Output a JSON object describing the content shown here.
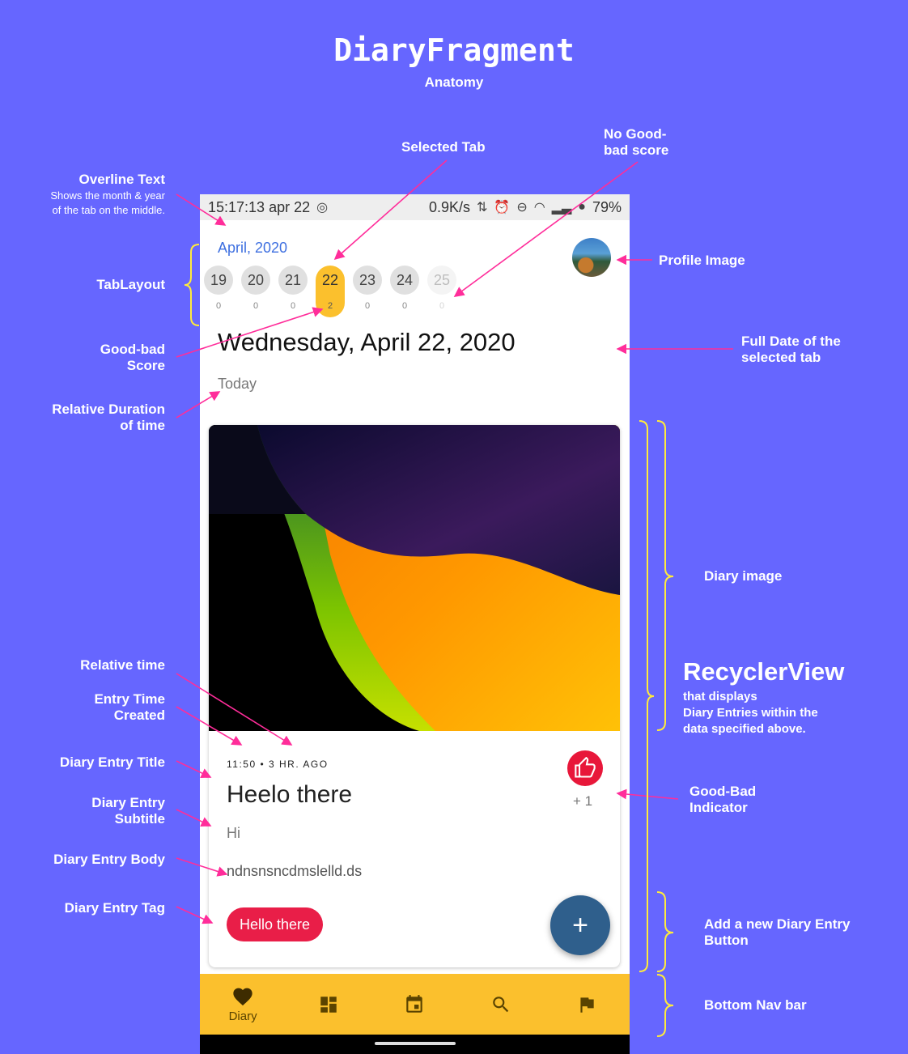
{
  "header": {
    "title": "DiaryFragment",
    "subtitle": "Anatomy"
  },
  "annotations": {
    "overline_text": "Overline Text",
    "overline_desc_1": "Shows the month & year",
    "overline_desc_2": "of the tab on the middle.",
    "selected_tab": "Selected Tab",
    "no_score_1": "No Good-",
    "no_score_2": "bad score",
    "profile_image": "Profile Image",
    "tab_layout": "TabLayout",
    "good_bad_score_1": "Good-bad",
    "good_bad_score_2": "Score",
    "full_date_1": "Full Date of the",
    "full_date_2": "selected tab",
    "relative_duration_1": "Relative Duration",
    "relative_duration_2": "of time",
    "diary_image": "Diary image",
    "recycler_title": "RecyclerView",
    "recycler_desc_1": "that displays",
    "recycler_desc_2": "Diary Entries within the",
    "recycler_desc_3": "data specified above.",
    "relative_time": "Relative time",
    "entry_time_1": "Entry Time",
    "entry_time_2": "Created",
    "entry_title": "Diary Entry Title",
    "entry_subtitle_1": "Diary Entry",
    "entry_subtitle_2": "Subtitle",
    "entry_body": "Diary Entry Body",
    "entry_tag": "Diary Entry Tag",
    "good_bad_indicator_1": "Good-Bad",
    "good_bad_indicator_2": "Indicator",
    "add_entry_1": "Add a new Diary Entry",
    "add_entry_2": "Button",
    "bottom_nav": "Bottom Nav bar"
  },
  "status_bar": {
    "time": "15:17:13 apr 22",
    "speed": "0.9K/s",
    "battery": "79%"
  },
  "app": {
    "overline": "April, 2020",
    "tabs": [
      {
        "day": "19",
        "score": "0"
      },
      {
        "day": "20",
        "score": "0"
      },
      {
        "day": "21",
        "score": "0"
      },
      {
        "day": "22",
        "score": "2"
      },
      {
        "day": "23",
        "score": "0"
      },
      {
        "day": "24",
        "score": "0"
      },
      {
        "day": "25",
        "score": "0"
      }
    ],
    "selected_tab_index": 3,
    "full_date": "Wednesday, April 22, 2020",
    "relative_duration": "Today",
    "entry": {
      "meta": "11:50 • 3 HR. AGO",
      "title": "Heelo there",
      "subtitle": "Hi",
      "body": "ndnsnsncdmslelld.ds",
      "tag": "Hello there",
      "good_bad_value": "+ 1"
    },
    "fab_icon": "plus-icon",
    "bottom_nav": [
      {
        "icon": "heart-icon",
        "label": "Diary"
      },
      {
        "icon": "dashboard-icon",
        "label": ""
      },
      {
        "icon": "calendar-icon",
        "label": ""
      },
      {
        "icon": "search-icon",
        "label": ""
      },
      {
        "icon": "flag-icon",
        "label": ""
      }
    ]
  },
  "colors": {
    "background": "#6666ff",
    "annotation_arrow": "#ff2d9a",
    "bracket": "#ffeb3b",
    "selected_tab": "#fbc02d",
    "bottom_nav": "#fbc02d",
    "fab": "#2f5f8c",
    "tag": "#e91e48",
    "overline": "#3d6fe0"
  }
}
